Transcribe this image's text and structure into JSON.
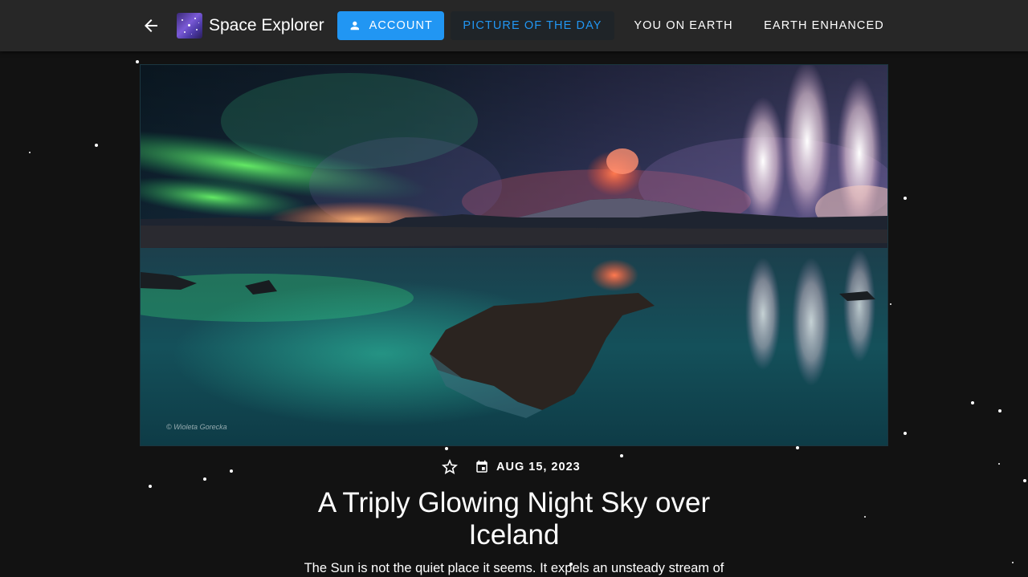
{
  "header": {
    "back_icon": "arrow-back-icon",
    "logo_icon": "galaxy-logo",
    "app_title": "Space Explorer",
    "nav": {
      "account_icon": "person-icon",
      "account": "ACCOUNT",
      "picture_of_the_day": "PICTURE OF THE DAY",
      "you_on_earth": "YOU ON EARTH",
      "earth_enhanced": "EARTH ENHANCED"
    },
    "colors": {
      "appbar": "#272727",
      "accent": "#2196f3",
      "active_bg": "#1f2428"
    }
  },
  "apod": {
    "image_credit": "© Wioleta Gorecka",
    "favorite_icon": "star-outline-icon",
    "calendar_icon": "calendar-icon",
    "date": "AUG 15, 2023",
    "title": "A Triply Glowing Night Sky over Iceland",
    "description": "The Sun is not the quiet place it seems. It expels an unsteady stream of"
  },
  "colors": {
    "background": "#121212",
    "text": "#ffffff"
  }
}
